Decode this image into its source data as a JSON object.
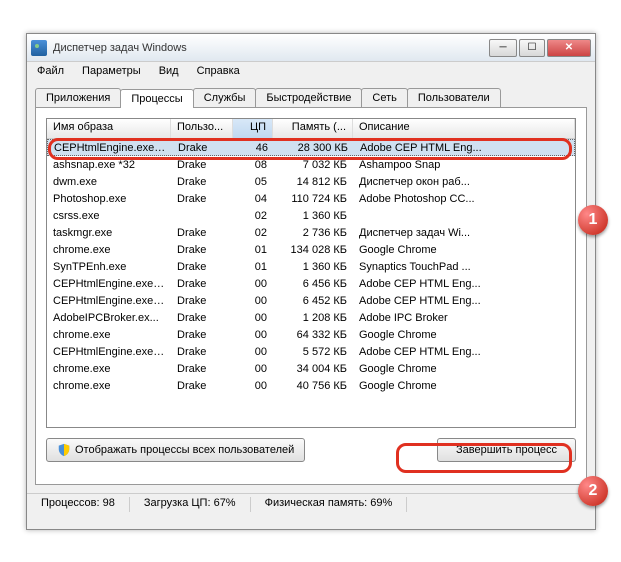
{
  "window": {
    "title": "Диспетчер задач Windows"
  },
  "menu": {
    "file": "Файл",
    "options": "Параметры",
    "view": "Вид",
    "help": "Справка"
  },
  "tabs": {
    "apps": "Приложения",
    "processes": "Процессы",
    "services": "Службы",
    "performance": "Быстродействие",
    "network": "Сеть",
    "users": "Пользователи"
  },
  "columns": {
    "image": "Имя образа",
    "user": "Пользо...",
    "cpu": "ЦП",
    "memory": "Память (...",
    "desc": "Описание"
  },
  "rows": [
    {
      "image": "CEPHtmlEngine.exe ...",
      "user": "Drake",
      "cpu": "46",
      "mem": "28 300 КБ",
      "desc": "Adobe CEP HTML Eng..."
    },
    {
      "image": "ashsnap.exe *32",
      "user": "Drake",
      "cpu": "08",
      "mem": "7 032 КБ",
      "desc": "Ashampoo Snap"
    },
    {
      "image": "dwm.exe",
      "user": "Drake",
      "cpu": "05",
      "mem": "14 812 КБ",
      "desc": "Диспетчер окон раб..."
    },
    {
      "image": "Photoshop.exe",
      "user": "Drake",
      "cpu": "04",
      "mem": "110 724 КБ",
      "desc": "Adobe Photoshop CC..."
    },
    {
      "image": "csrss.exe",
      "user": "",
      "cpu": "02",
      "mem": "1 360 КБ",
      "desc": ""
    },
    {
      "image": "taskmgr.exe",
      "user": "Drake",
      "cpu": "02",
      "mem": "2 736 КБ",
      "desc": "Диспетчер задач Wi..."
    },
    {
      "image": "chrome.exe",
      "user": "Drake",
      "cpu": "01",
      "mem": "134 028 КБ",
      "desc": "Google Chrome"
    },
    {
      "image": "SynTPEnh.exe",
      "user": "Drake",
      "cpu": "01",
      "mem": "1 360 КБ",
      "desc": "Synaptics TouchPad ..."
    },
    {
      "image": "CEPHtmlEngine.exe ...",
      "user": "Drake",
      "cpu": "00",
      "mem": "6 456 КБ",
      "desc": "Adobe CEP HTML Eng..."
    },
    {
      "image": "CEPHtmlEngine.exe ...",
      "user": "Drake",
      "cpu": "00",
      "mem": "6 452 КБ",
      "desc": "Adobe CEP HTML Eng..."
    },
    {
      "image": "AdobeIPCBroker.ex...",
      "user": "Drake",
      "cpu": "00",
      "mem": "1 208 КБ",
      "desc": "Adobe IPC Broker"
    },
    {
      "image": "chrome.exe",
      "user": "Drake",
      "cpu": "00",
      "mem": "64 332 КБ",
      "desc": "Google Chrome"
    },
    {
      "image": "CEPHtmlEngine.exe ...",
      "user": "Drake",
      "cpu": "00",
      "mem": "5 572 КБ",
      "desc": "Adobe CEP HTML Eng..."
    },
    {
      "image": "chrome.exe",
      "user": "Drake",
      "cpu": "00",
      "mem": "34 004 КБ",
      "desc": "Google Chrome"
    },
    {
      "image": "chrome.exe",
      "user": "Drake",
      "cpu": "00",
      "mem": "40 756 КБ",
      "desc": "Google Chrome"
    }
  ],
  "buttons": {
    "showAll": "Отображать процессы всех пользователей",
    "end": "Завершить процесс"
  },
  "status": {
    "procs": "Процессов: 98",
    "cpu": "Загрузка ЦП: 67%",
    "mem": "Физическая память: 69%"
  },
  "badges": {
    "one": "1",
    "two": "2"
  }
}
